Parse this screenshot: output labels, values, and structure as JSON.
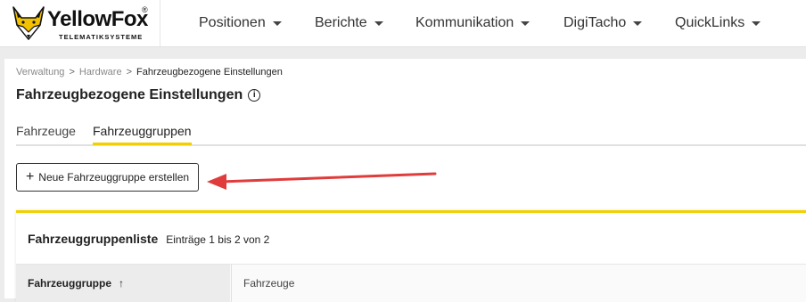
{
  "brand": {
    "name": "YellowFox",
    "registered": "®",
    "tagline": "TELEMATIKSYSTEME",
    "logo_icon": "fox-head-logo",
    "accent_color": "#f2d000"
  },
  "nav": {
    "items": [
      {
        "label": "Positionen",
        "icon": "chevron-down-icon"
      },
      {
        "label": "Berichte",
        "icon": "chevron-down-icon"
      },
      {
        "label": "Kommunikation",
        "icon": "chevron-down-icon"
      },
      {
        "label": "DigiTacho",
        "icon": "chevron-down-icon"
      },
      {
        "label": "QuickLinks",
        "icon": "chevron-down-icon"
      }
    ]
  },
  "breadcrumb": {
    "items": [
      "Verwaltung",
      "Hardware",
      "Fahrzeugbezogene Einstellungen"
    ],
    "separator": ">"
  },
  "page": {
    "title": "Fahrzeugbezogene Einstellungen",
    "info_icon": "i"
  },
  "tabs": [
    {
      "label": "Fahrzeuge",
      "active": false
    },
    {
      "label": "Fahrzeuggruppen",
      "active": true
    }
  ],
  "actions": {
    "new_group_label": "Neue Fahrzeuggruppe erstellen",
    "new_group_icon": "+"
  },
  "annotation": {
    "arrow_color": "#e03c3c"
  },
  "list": {
    "title": "Fahrzeuggruppenliste",
    "count_text": "Einträge 1 bis 2 von 2",
    "columns": [
      {
        "label": "Fahrzeuggruppe",
        "sort": "↑"
      },
      {
        "label": "Fahrzeuge"
      }
    ]
  }
}
